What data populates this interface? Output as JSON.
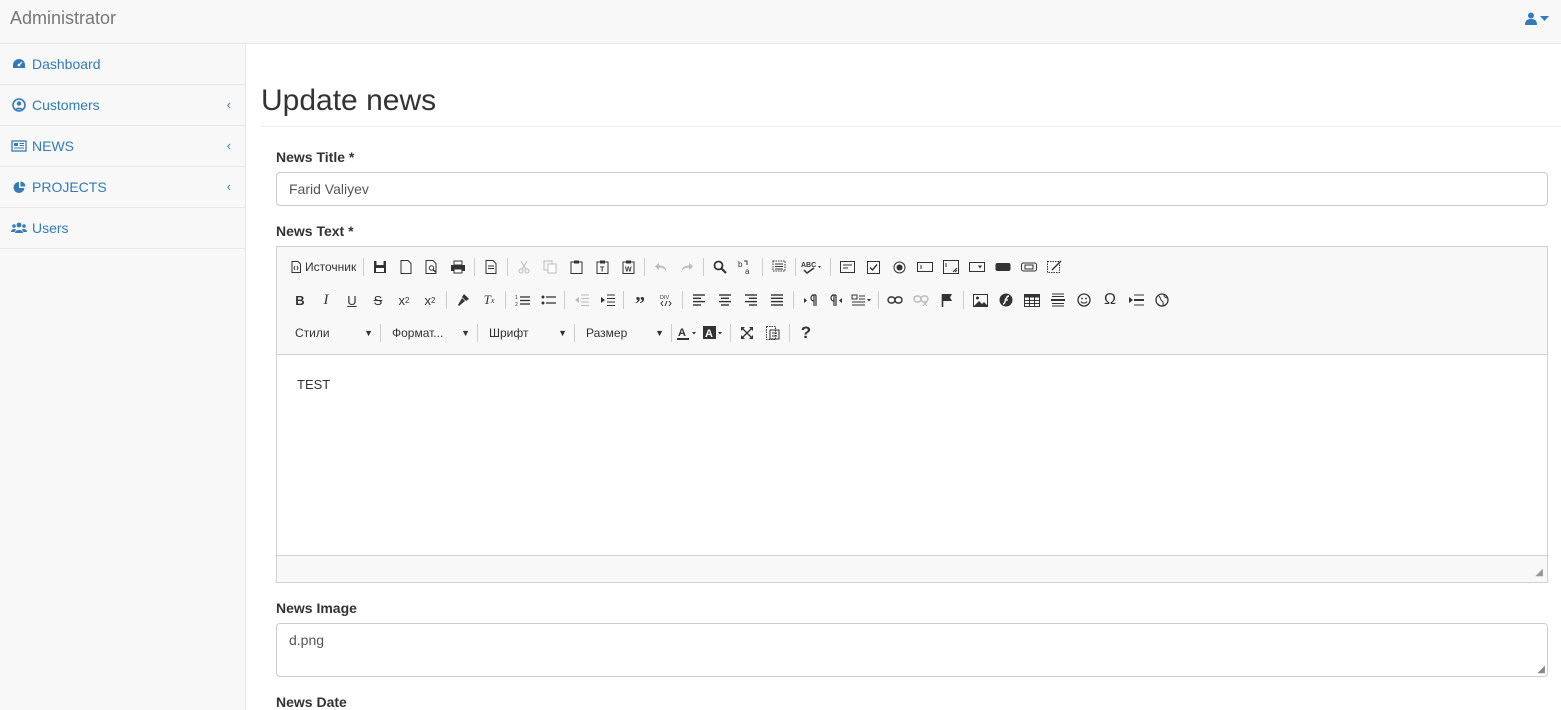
{
  "header": {
    "brand": "Administrator",
    "user_icon": "user-icon"
  },
  "sidebar": {
    "items": [
      {
        "label": "Dashboard",
        "icon": "dashboard-icon",
        "has_children": false
      },
      {
        "label": "Customers",
        "icon": "user-circle-icon",
        "has_children": true
      },
      {
        "label": "NEWS",
        "icon": "newspaper-icon",
        "has_children": true
      },
      {
        "label": "PROJECTS",
        "icon": "pie-chart-icon",
        "has_children": true
      },
      {
        "label": "Users",
        "icon": "users-icon",
        "has_children": false
      }
    ]
  },
  "page": {
    "title": "Update news"
  },
  "form": {
    "news_title": {
      "label": "News Title *",
      "value": "Farid Valiyev"
    },
    "news_text": {
      "label": "News Text *",
      "source_button": "Источник",
      "styles_combo": "Стили",
      "format_combo": "Формат...",
      "font_combo": "Шрифт",
      "size_combo": "Размер",
      "content": "TEST"
    },
    "news_image": {
      "label": "News Image",
      "value": "d.png"
    },
    "news_date": {
      "label": "News Date"
    }
  },
  "colors": {
    "link": "#337ab7",
    "navbar_bg": "#f8f8f8",
    "border": "#e7e7e7"
  }
}
